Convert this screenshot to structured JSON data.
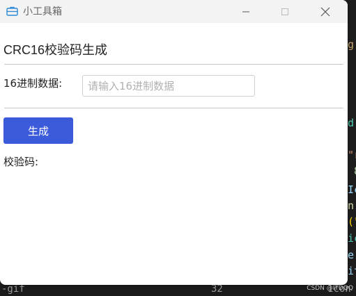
{
  "window": {
    "title": "小工具箱",
    "minimize_glyph": "—",
    "maximize_glyph": "☐",
    "close_glyph": "✕"
  },
  "main": {
    "heading": "CRC16校验码生成",
    "hex_label": "16进制数据:",
    "hex_input_value": "",
    "hex_input_placeholder": "请输入16进制数据",
    "generate_label": "生成",
    "result_label": "校验码:"
  },
  "background": {
    "lines": [
      "g",
      "",
      "d",
      "\"r",
      " 8",
      "Ic",
      "n",
      "(\"",
      "ic",
      "e",
      "it",
      "1con"
    ],
    "status_left": "-gif",
    "status_mid": "32",
    "watermark": "CSDN @ITDQQ"
  },
  "colors": {
    "accent": "#3b5bdb",
    "titlebar": "#f3f3f3"
  }
}
